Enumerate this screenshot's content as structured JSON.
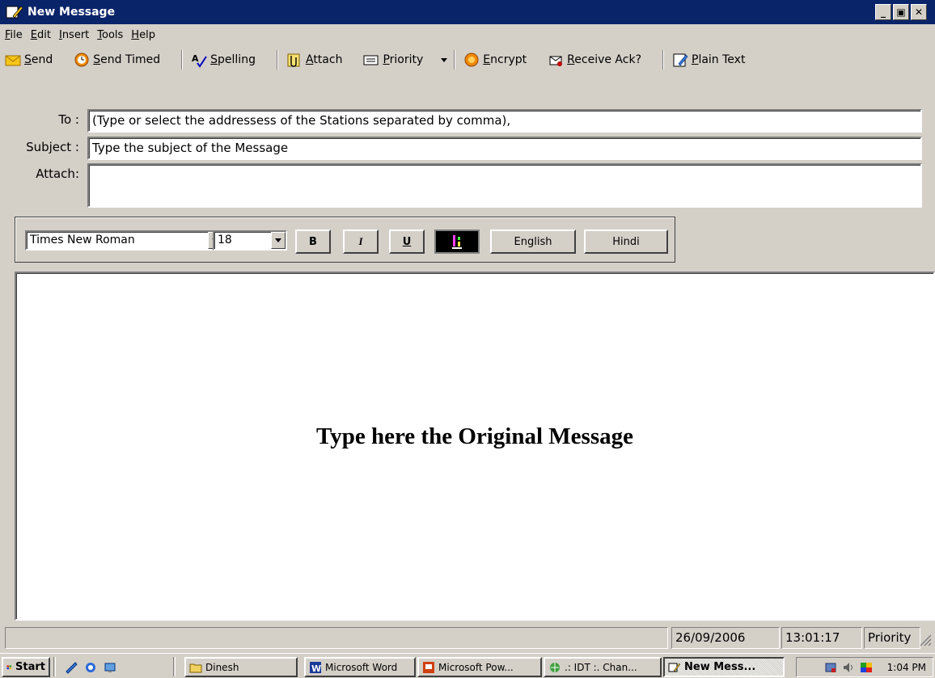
{
  "window": {
    "title": "New Message"
  },
  "menu": {
    "items": [
      {
        "label": "File",
        "accel": "F",
        "rest": "ile"
      },
      {
        "label": "Edit",
        "accel": "E",
        "rest": "dit"
      },
      {
        "label": "Insert",
        "accel": "I",
        "rest": "nsert"
      },
      {
        "label": "Tools",
        "accel": "T",
        "rest": "ools"
      },
      {
        "label": "Help",
        "accel": "H",
        "rest": "elp"
      }
    ]
  },
  "toolbar": {
    "send": {
      "accel": "S",
      "rest": "end",
      "icon": "envelope-icon"
    },
    "send_timed": {
      "accel": "S",
      "rest": "end Timed",
      "icon": "clock-icon"
    },
    "spelling": {
      "accel": "S",
      "rest": "pelling",
      "icon": "spellcheck-icon"
    },
    "attach": {
      "accel": "A",
      "rest": "ttach",
      "icon": "paperclip-icon"
    },
    "priority": {
      "accel": "P",
      "rest": "riority",
      "icon": "priority-icon"
    },
    "encrypt": {
      "accel": "E",
      "rest": "ncrypt",
      "icon": "lock-icon"
    },
    "receive_ack": {
      "accel": "R",
      "rest": "eceive Ack?",
      "icon": "receipt-icon"
    },
    "plain_text": {
      "accel": "P",
      "rest": "lain Text",
      "icon": "pencil-icon"
    }
  },
  "fields": {
    "to_label": "To :",
    "to_value": "(Type or select the addressess of the Stations separated by comma),",
    "subject_label": "Subject :",
    "subject_value": "Type the subject of the Message",
    "attach_label": "Attach:",
    "attach_value": ""
  },
  "format": {
    "font_name": "Times New Roman",
    "font_size": "18",
    "bold": "B",
    "italic": "I",
    "underline": "U",
    "english": "English",
    "hindi": "Hindi"
  },
  "editor": {
    "body": "Type here the Original Message"
  },
  "status": {
    "message": "",
    "date": "26/09/2006",
    "time": "13:01:17",
    "priority": "Priority"
  },
  "taskbar": {
    "start": "Start",
    "tasks": [
      {
        "label": "Dinesh"
      },
      {
        "label": "Microsoft Word"
      },
      {
        "label": "Microsoft Pow..."
      },
      {
        "label": ".: IDT :. Chan..."
      },
      {
        "label": "New Mess..."
      }
    ],
    "clock": "1:04 PM"
  },
  "colors": {
    "titlebar": "#0a246a",
    "chrome": "#d4d0c8",
    "editor_bg": "#ffffff"
  }
}
